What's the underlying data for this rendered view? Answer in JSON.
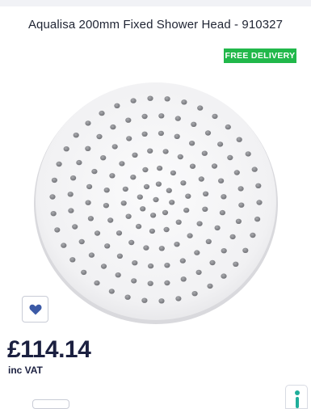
{
  "product": {
    "title": "Aqualisa 200mm Fixed Shower Head - 910327",
    "badge": "FREE DELIVERY",
    "price": "£114.14",
    "vat_note": "inc VAT"
  },
  "icons": {
    "wishlist": "heart-icon",
    "help": "info-icon"
  },
  "colors": {
    "badge_bg": "#21b84a",
    "heart": "#3c5aa6",
    "price_text": "#1b2040",
    "help_accent": "#1fae9a"
  }
}
